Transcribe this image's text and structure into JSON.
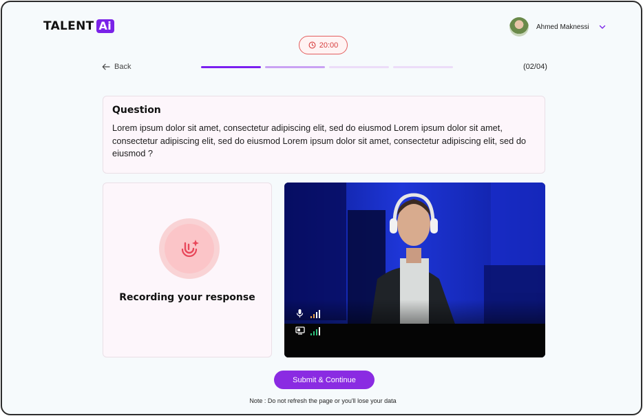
{
  "brand": {
    "name": "TALENT",
    "badge": "Ai",
    "accent": "#7a22e8"
  },
  "user": {
    "name": "Ahmed Maknessi"
  },
  "timer": {
    "value": "20:00"
  },
  "nav": {
    "back_label": "Back",
    "counter": "(02/04)",
    "current_step": 2,
    "total_steps": 4
  },
  "question": {
    "title": "Question",
    "text": "Lorem ipsum dolor sit amet, consectetur adipiscing elit, sed do eiusmod Lorem ipsum dolor sit amet, consectetur adipiscing elit, sed do eiusmod Lorem ipsum dolor sit amet, consectetur adipiscing elit, sed do eiusmod ?"
  },
  "recording": {
    "label": "Recording your response",
    "icon": "mic-sparkle-icon"
  },
  "video": {
    "mic_level": "4 of 4 bars",
    "connection_level": "4 of 4 bars"
  },
  "actions": {
    "submit_label": "Submit & Continue"
  },
  "note": "Note : Do not refresh the page or you'll lose your data"
}
